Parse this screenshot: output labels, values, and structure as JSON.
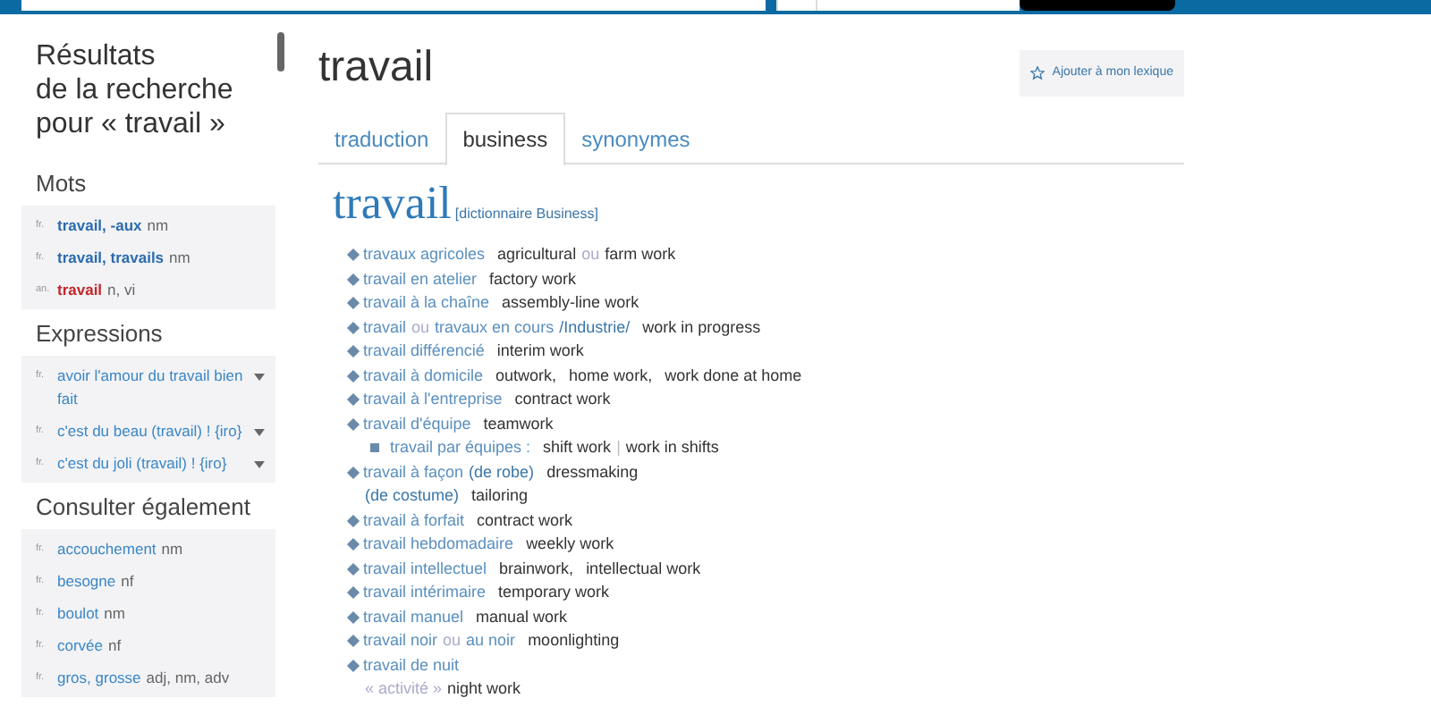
{
  "sidebar": {
    "title_lines": [
      "Résultats",
      "de la recherche",
      "pour « travail »"
    ],
    "sections": [
      {
        "title": "Mots",
        "items": [
          {
            "kind": "fr-word",
            "lang": "fr.",
            "word": "travail, -aux",
            "gram": "nm"
          },
          {
            "kind": "fr-word",
            "lang": "fr.",
            "word": "travail, travails",
            "gram": "nm"
          },
          {
            "kind": "en-word",
            "lang": "an.",
            "word": "travail",
            "gram": "n, vi"
          }
        ]
      },
      {
        "title": "Expressions",
        "items": [
          {
            "kind": "expression",
            "lang": "fr.",
            "word": "avoir l'amour du travail bien fait",
            "expandable": true
          },
          {
            "kind": "expression",
            "lang": "fr.",
            "word": "c'est du beau (travail) ! {iro}",
            "expandable": true
          },
          {
            "kind": "expression",
            "lang": "fr.",
            "word": "c'est du joli (travail) ! {iro}",
            "expandable": true
          }
        ]
      },
      {
        "title": "Consulter également",
        "items": [
          {
            "kind": "link",
            "lang": "fr.",
            "word": "accouchement",
            "gram": "nm"
          },
          {
            "kind": "link",
            "lang": "fr.",
            "word": "besogne",
            "gram": "nf"
          },
          {
            "kind": "link",
            "lang": "fr.",
            "word": "boulot",
            "gram": "nm"
          },
          {
            "kind": "link",
            "lang": "fr.",
            "word": "corvée",
            "gram": "nf"
          },
          {
            "kind": "link",
            "lang": "fr.",
            "word": "gros, grosse",
            "gram": "adj, nm, adv"
          }
        ]
      }
    ]
  },
  "main": {
    "title": "travail",
    "add_button": "Ajouter à mon lexique",
    "tabs": [
      {
        "label": "traduction",
        "selected": false
      },
      {
        "label": "business",
        "selected": true
      },
      {
        "label": "synonymes",
        "selected": false
      }
    ],
    "headword": "travail",
    "dictionary": "[dictionnaire Business]",
    "entries": [
      {
        "kind": "main",
        "parts": [
          {
            "kind": "fr",
            "text": "travaux agricoles"
          },
          {
            "kind": "en",
            "text": "agricultural"
          },
          {
            "kind": "ou",
            "text": "ou"
          },
          {
            "kind": "en",
            "text": "farm work"
          }
        ]
      },
      {
        "kind": "main",
        "parts": [
          {
            "kind": "fr",
            "text": "travail en atelier"
          },
          {
            "kind": "en",
            "text": "factory work"
          }
        ]
      },
      {
        "kind": "main",
        "parts": [
          {
            "kind": "fr",
            "text": "travail à la chaîne"
          },
          {
            "kind": "en",
            "text": "assembly-line work"
          }
        ]
      },
      {
        "kind": "main",
        "parts": [
          {
            "kind": "fr",
            "text": "travail"
          },
          {
            "kind": "ou",
            "text": "ou"
          },
          {
            "kind": "fr",
            "text": "travaux en cours"
          },
          {
            "kind": "domain",
            "text": "/Industrie/"
          },
          {
            "kind": "en",
            "text": "work in progress"
          }
        ]
      },
      {
        "kind": "main",
        "parts": [
          {
            "kind": "fr",
            "text": "travail différencié"
          },
          {
            "kind": "en",
            "text": "interim work"
          }
        ]
      },
      {
        "kind": "main",
        "parts": [
          {
            "kind": "fr",
            "text": "travail à domicile"
          },
          {
            "kind": "en",
            "text": "outwork,"
          },
          {
            "kind": "en",
            "text": "home work,"
          },
          {
            "kind": "en",
            "text": "work done at home"
          }
        ]
      },
      {
        "kind": "main",
        "parts": [
          {
            "kind": "fr",
            "text": "travail à l'entreprise"
          },
          {
            "kind": "en",
            "text": "contract work"
          }
        ]
      },
      {
        "kind": "main",
        "parts": [
          {
            "kind": "fr",
            "text": "travail d'équipe"
          },
          {
            "kind": "en",
            "text": "teamwork"
          }
        ]
      },
      {
        "kind": "sub",
        "parts": [
          {
            "kind": "fr",
            "text": "travail par équipes :"
          },
          {
            "kind": "en",
            "text": "shift work"
          },
          {
            "kind": "sep",
            "text": "|"
          },
          {
            "kind": "en",
            "text": "work in shifts"
          }
        ]
      },
      {
        "kind": "main",
        "parts": [
          {
            "kind": "fr",
            "text": "travail à façon"
          },
          {
            "kind": "domain",
            "text": "(de robe)"
          },
          {
            "kind": "en",
            "text": "dressmaking"
          }
        ]
      },
      {
        "kind": "cont",
        "parts": [
          {
            "kind": "domain",
            "text": "(de costume)"
          },
          {
            "kind": "en",
            "text": "tailoring"
          }
        ]
      },
      {
        "kind": "main",
        "parts": [
          {
            "kind": "fr",
            "text": "travail à forfait"
          },
          {
            "kind": "en",
            "text": "contract work"
          }
        ]
      },
      {
        "kind": "main",
        "parts": [
          {
            "kind": "fr",
            "text": "travail hebdomadaire"
          },
          {
            "kind": "en",
            "text": "weekly work"
          }
        ]
      },
      {
        "kind": "main",
        "parts": [
          {
            "kind": "fr",
            "text": "travail intellectuel"
          },
          {
            "kind": "en",
            "text": "brainwork,"
          },
          {
            "kind": "en",
            "text": "intellectual work"
          }
        ]
      },
      {
        "kind": "main",
        "parts": [
          {
            "kind": "fr",
            "text": "travail intérimaire"
          },
          {
            "kind": "en",
            "text": "temporary work"
          }
        ]
      },
      {
        "kind": "main",
        "parts": [
          {
            "kind": "fr",
            "text": "travail manuel"
          },
          {
            "kind": "en",
            "text": "manual work"
          }
        ]
      },
      {
        "kind": "main",
        "parts": [
          {
            "kind": "fr",
            "text": "travail noir"
          },
          {
            "kind": "ou",
            "text": "ou"
          },
          {
            "kind": "fr",
            "text": "au noir"
          },
          {
            "kind": "en",
            "text": "moonlighting"
          }
        ]
      },
      {
        "kind": "main",
        "parts": [
          {
            "kind": "fr",
            "text": "travail de nuit"
          }
        ]
      },
      {
        "kind": "cont",
        "parts": [
          {
            "kind": "ou",
            "text": "« activité »"
          },
          {
            "kind": "en",
            "text": "night work"
          }
        ]
      }
    ]
  }
}
